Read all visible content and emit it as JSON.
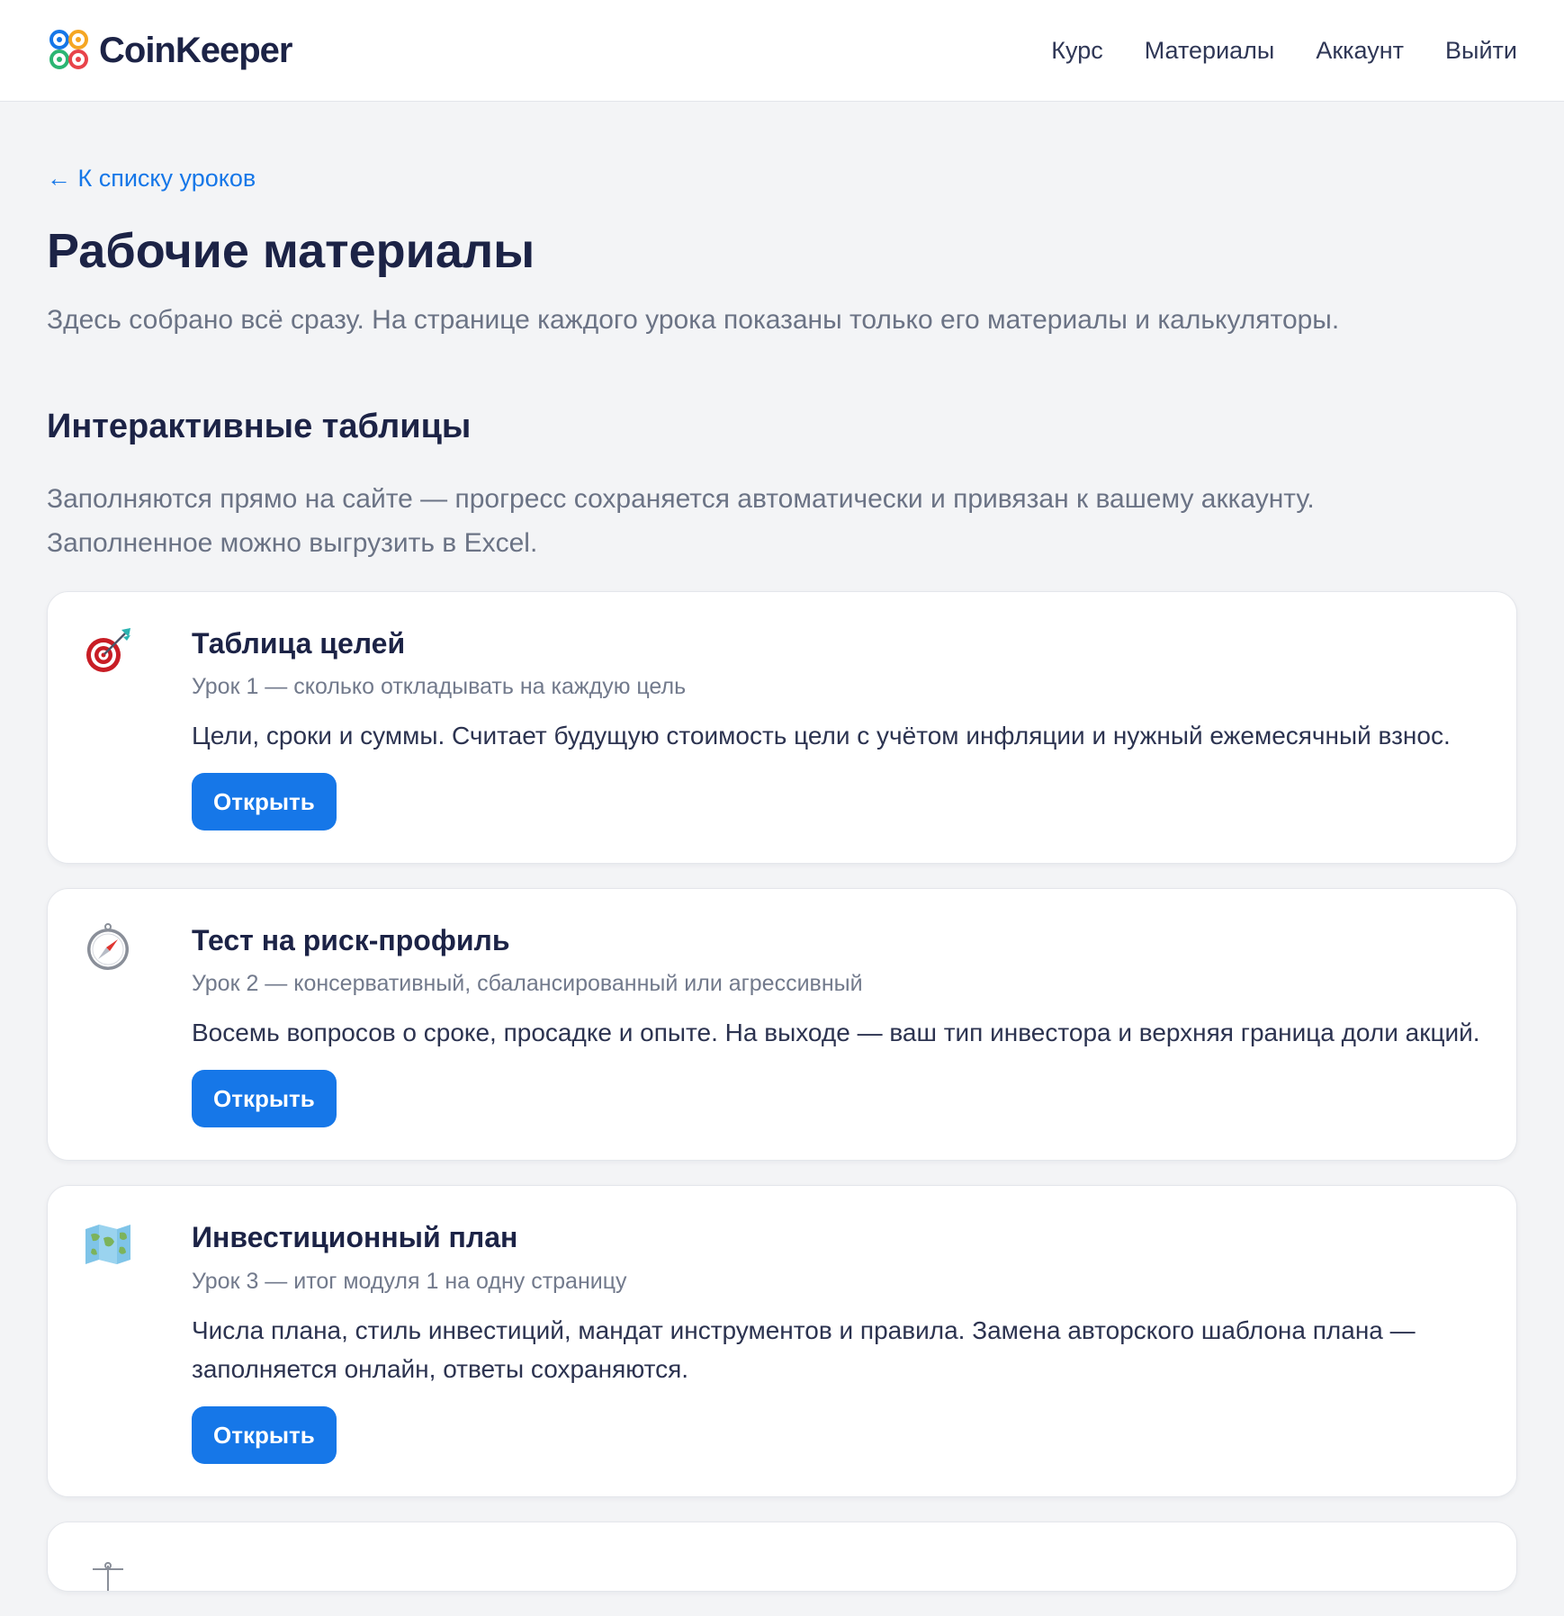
{
  "header": {
    "logo_text": "CoinKeeper",
    "nav": [
      "Курс",
      "Материалы",
      "Аккаунт",
      "Выйти"
    ]
  },
  "main": {
    "back_link": "← К списку уроков",
    "title": "Рабочие материалы",
    "subtitle": "Здесь собрано всё сразу. На странице каждого урока показаны только его материалы и калькуляторы.",
    "section": {
      "title": "Интерактивные таблицы",
      "desc_line1": "Заполняются прямо на сайте — прогресс сохраняется автоматически и привязан к вашему аккаунту.",
      "desc_line2": "Заполненное можно выгрузить в Excel."
    },
    "cards": [
      {
        "icon": "target-icon",
        "title": "Таблица целей",
        "lesson": "Урок 1 — сколько откладывать на каждую цель",
        "desc": "Цели, сроки и суммы. Считает будущую стоимость цели с учётом инфляции и нужный ежемесячный взнос.",
        "button": "Открыть"
      },
      {
        "icon": "compass-icon",
        "title": "Тест на риск-профиль",
        "lesson": "Урок 2 — консервативный, сбалансированный или агрессивный",
        "desc": "Восемь вопросов о сроке, просадке и опыте. На выходе — ваш тип инвестора и верхняя граница доли акций.",
        "button": "Открыть"
      },
      {
        "icon": "map-icon",
        "title": "Инвестиционный план",
        "lesson": "Урок 3 — итог модуля 1 на одну страницу",
        "desc": "Числа плана, стиль инвестиций, мандат инструментов и правила. Замена авторского шаблона плана — заполняется онлайн, ответы сохраняются.",
        "button": "Открыть"
      }
    ]
  },
  "colors": {
    "accent": "#1677e8",
    "title": "#1c2346",
    "muted": "#6b7385",
    "background": "#f3f4f6"
  }
}
